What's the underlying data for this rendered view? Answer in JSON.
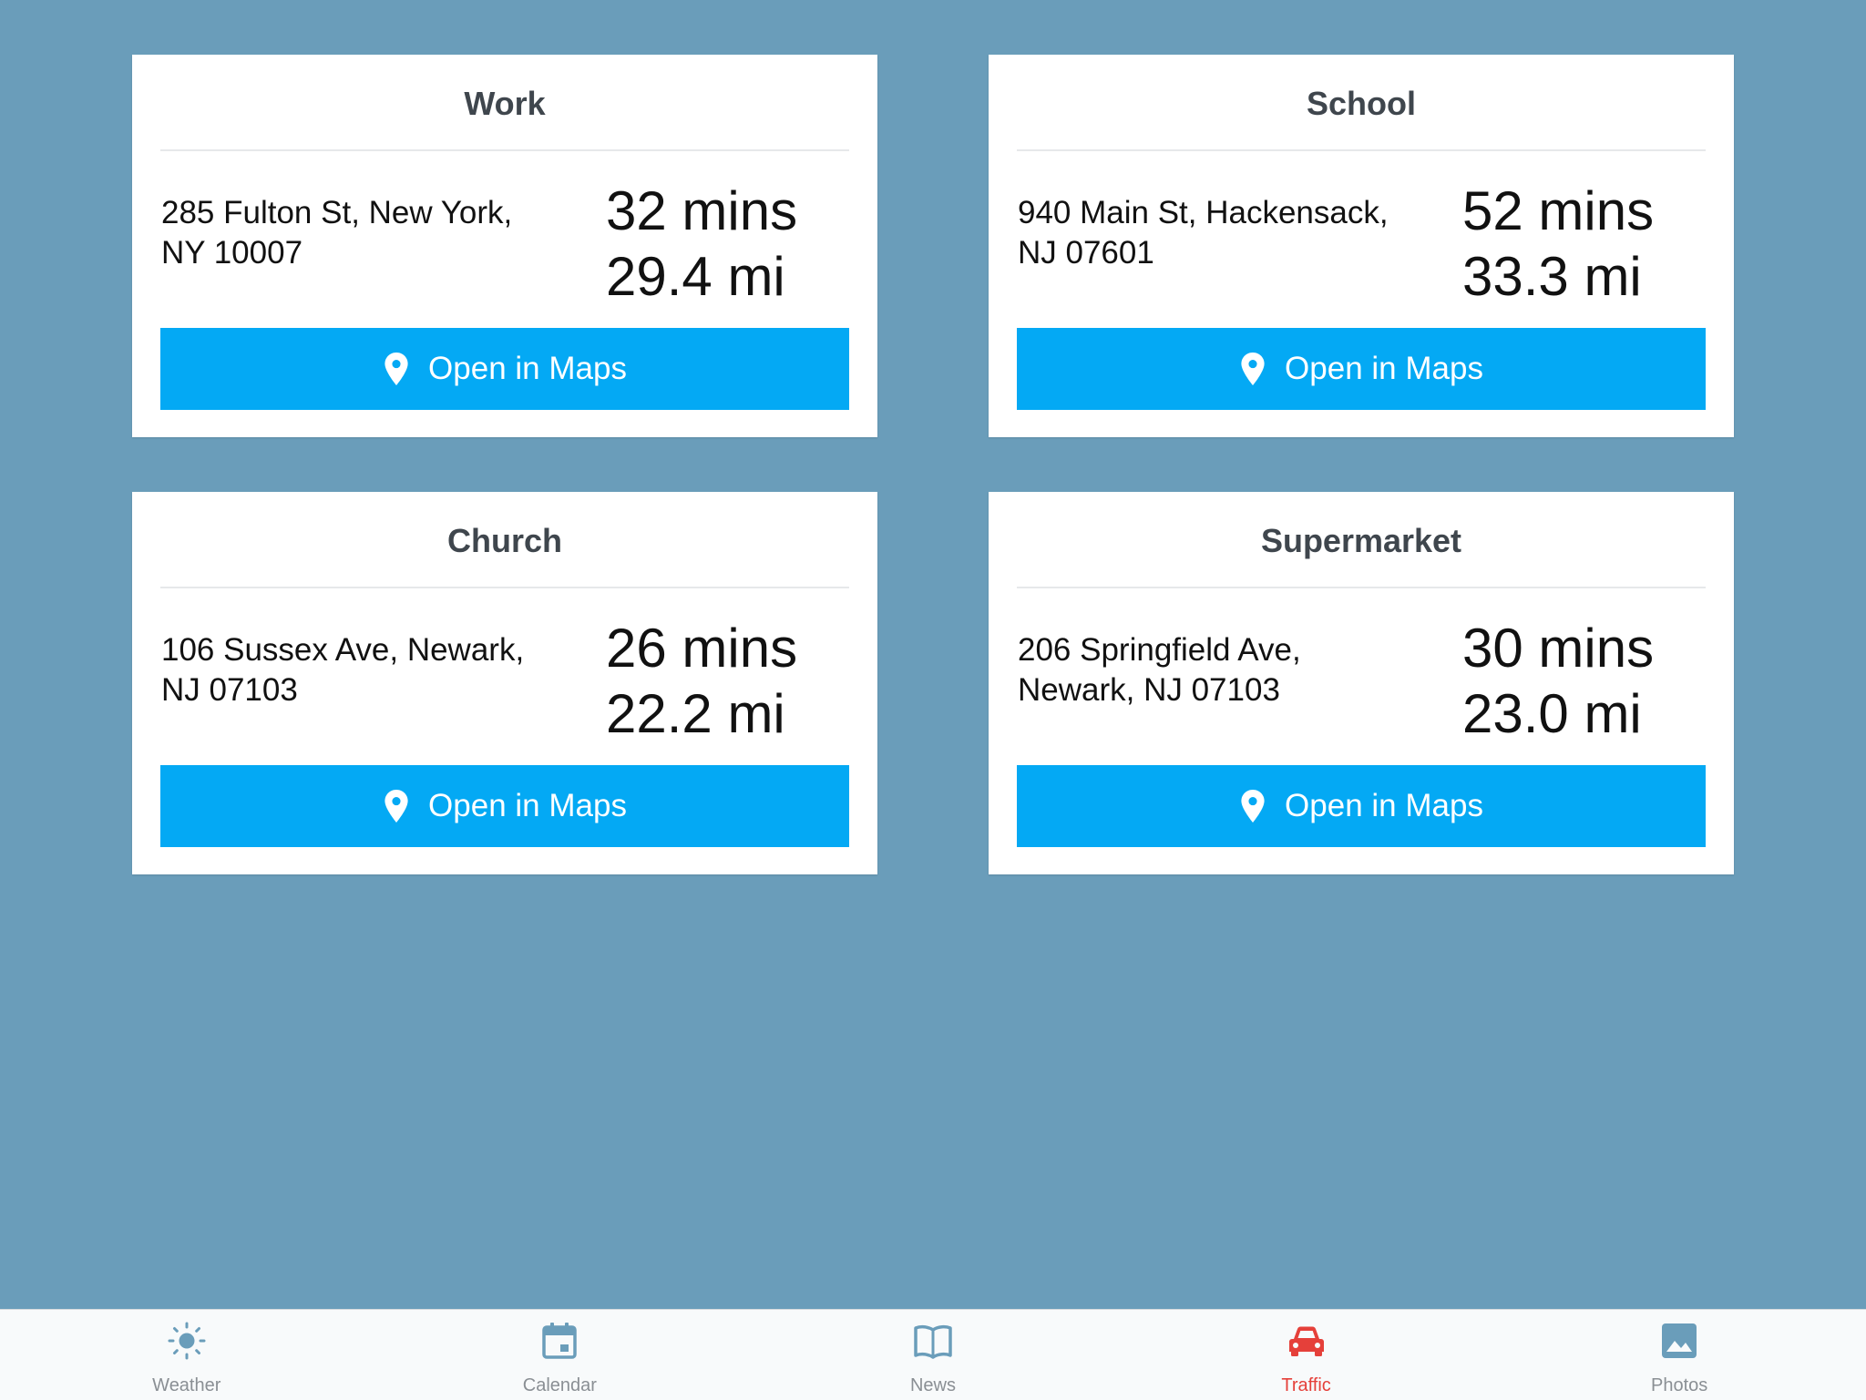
{
  "cards": [
    {
      "title": "Work",
      "address": "285 Fulton St, New York, NY 10007",
      "time": "32 mins",
      "distance": "29.4 mi",
      "button_label": "Open in Maps"
    },
    {
      "title": "School",
      "address": "940 Main St, Hackensack, NJ 07601",
      "time": "52 mins",
      "distance": "33.3 mi",
      "button_label": "Open in Maps"
    },
    {
      "title": "Church",
      "address": "106 Sussex Ave, Newark, NJ 07103",
      "time": "26 mins",
      "distance": "22.2 mi",
      "button_label": "Open in Maps"
    },
    {
      "title": "Supermarket",
      "address": "206 Springfield Ave, Newark, NJ 07103",
      "time": "30 mins",
      "distance": "23.0 mi",
      "button_label": "Open in Maps"
    }
  ],
  "tabbar": {
    "active": "Traffic",
    "tabs": [
      {
        "label": "Weather",
        "icon": "sun-icon"
      },
      {
        "label": "Calendar",
        "icon": "calendar-icon"
      },
      {
        "label": "News",
        "icon": "book-icon"
      },
      {
        "label": "Traffic",
        "icon": "car-icon"
      },
      {
        "label": "Photos",
        "icon": "image-icon"
      }
    ]
  },
  "colors": {
    "background": "#6a9dba",
    "button": "#04a9f4",
    "tab_inactive": "#6a9dba",
    "tab_active": "#e5403a"
  }
}
